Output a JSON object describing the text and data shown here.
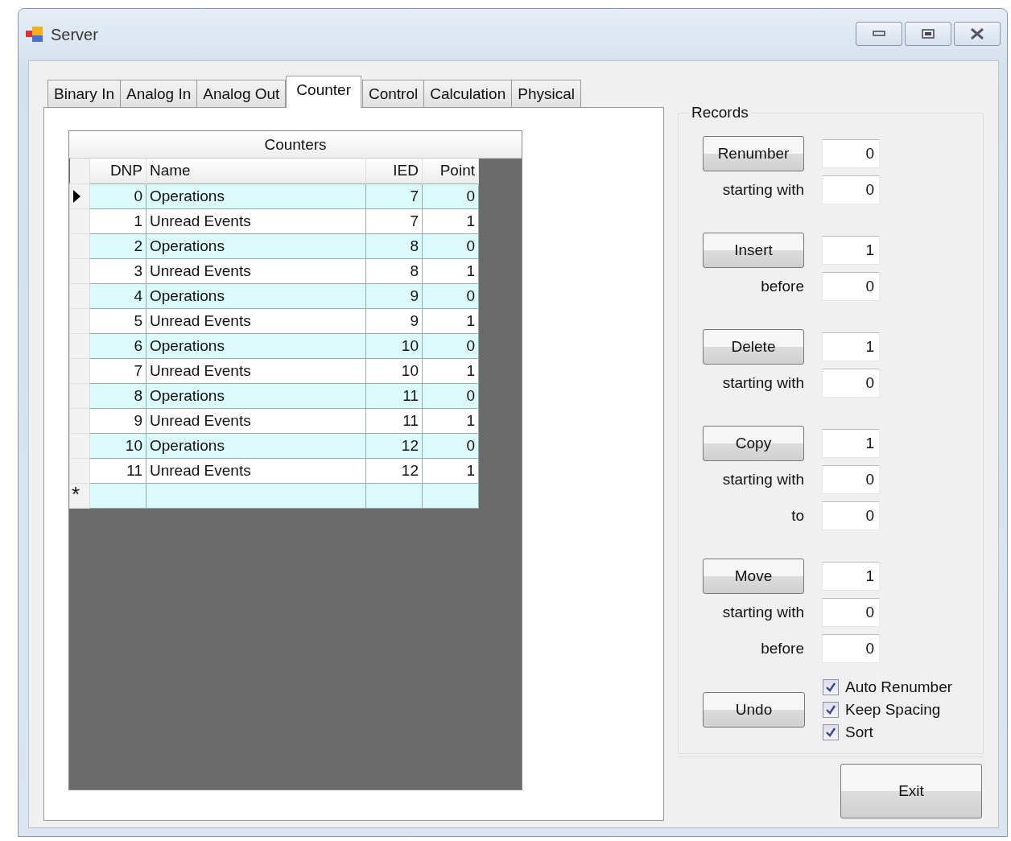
{
  "window": {
    "title": "Server"
  },
  "tabs": [
    {
      "label": "Binary In",
      "selected": false
    },
    {
      "label": "Analog In",
      "selected": false
    },
    {
      "label": "Analog Out",
      "selected": false
    },
    {
      "label": "Counter",
      "selected": true
    },
    {
      "label": "Control",
      "selected": false
    },
    {
      "label": "Calculation",
      "selected": false
    },
    {
      "label": "Physical",
      "selected": false
    }
  ],
  "grid": {
    "title": "Counters",
    "columns": [
      "DNP",
      "Name",
      "IED",
      "Point"
    ],
    "rows": [
      {
        "cells": [
          "0",
          "Operations",
          "7",
          "0"
        ],
        "current": true
      },
      {
        "cells": [
          "1",
          "Unread Events",
          "7",
          "1"
        ],
        "current": false
      },
      {
        "cells": [
          "2",
          "Operations",
          "8",
          "0"
        ],
        "current": false
      },
      {
        "cells": [
          "3",
          "Unread Events",
          "8",
          "1"
        ],
        "current": false
      },
      {
        "cells": [
          "4",
          "Operations",
          "9",
          "0"
        ],
        "current": false
      },
      {
        "cells": [
          "5",
          "Unread Events",
          "9",
          "1"
        ],
        "current": false
      },
      {
        "cells": [
          "6",
          "Operations",
          "10",
          "0"
        ],
        "current": false
      },
      {
        "cells": [
          "7",
          "Unread Events",
          "10",
          "1"
        ],
        "current": false
      },
      {
        "cells": [
          "8",
          "Operations",
          "11",
          "0"
        ],
        "current": false
      },
      {
        "cells": [
          "9",
          "Unread Events",
          "11",
          "1"
        ],
        "current": false
      },
      {
        "cells": [
          "10",
          "Operations",
          "12",
          "0"
        ],
        "current": false
      },
      {
        "cells": [
          "11",
          "Unread Events",
          "12",
          "1"
        ],
        "current": false
      }
    ],
    "new_row_marker": "*"
  },
  "records": {
    "title": "Records",
    "actions": [
      {
        "button": "Renumber",
        "fields": [
          {
            "value": "0"
          },
          {
            "label": "starting with",
            "value": "0"
          }
        ]
      },
      {
        "button": "Insert",
        "fields": [
          {
            "value": "1"
          },
          {
            "label": "before",
            "value": "0"
          }
        ]
      },
      {
        "button": "Delete",
        "fields": [
          {
            "value": "1"
          },
          {
            "label": "starting with",
            "value": "0"
          }
        ]
      },
      {
        "button": "Copy",
        "fields": [
          {
            "value": "1"
          },
          {
            "label": "starting with",
            "value": "0"
          },
          {
            "label": "to",
            "value": "0"
          }
        ]
      },
      {
        "button": "Move",
        "fields": [
          {
            "value": "1"
          },
          {
            "label": "starting with",
            "value": "0"
          },
          {
            "label": "before",
            "value": "0"
          }
        ]
      }
    ],
    "undo_button": "Undo",
    "options": [
      {
        "label": "Auto Renumber",
        "checked": true
      },
      {
        "label": "Keep Spacing",
        "checked": true
      },
      {
        "label": "Sort",
        "checked": true
      }
    ]
  },
  "exit_button": "Exit"
}
